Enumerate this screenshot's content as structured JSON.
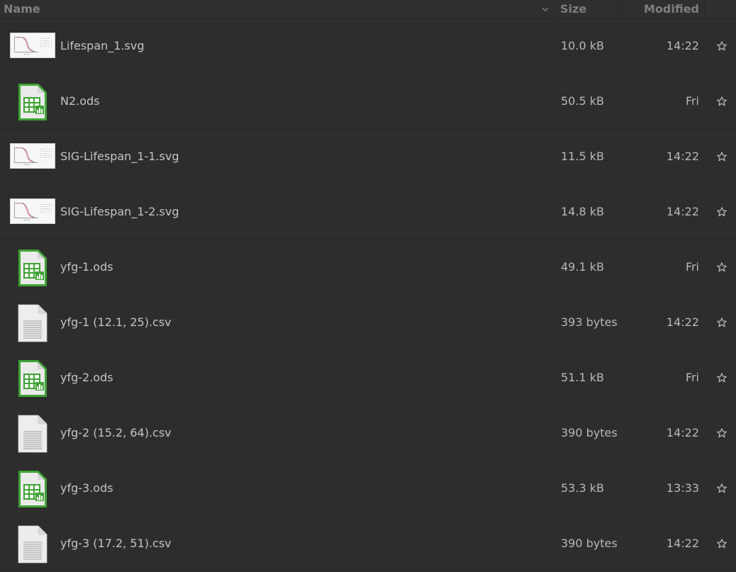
{
  "header": {
    "name": "Name",
    "size": "Size",
    "modified": "Modified"
  },
  "icons": {
    "sort": "chevron-down-icon",
    "star": "star-outline-icon",
    "svg": "svg-image-thumbnail",
    "ods": "spreadsheet-icon",
    "csv": "text-document-icon"
  },
  "colors": {
    "background": "#2b2b2b",
    "text": "#c4c4c4",
    "ods_green": "#3fa334"
  },
  "files": [
    {
      "name": "Lifespan_1.svg",
      "size": "10.0 kB",
      "modified": "14:22",
      "kind": "svg"
    },
    {
      "name": "N2.ods",
      "size": "50.5 kB",
      "modified": "Fri",
      "kind": "ods"
    },
    {
      "name": "SIG-Lifespan_1-1.svg",
      "size": "11.5 kB",
      "modified": "14:22",
      "kind": "svg"
    },
    {
      "name": "SIG-Lifespan_1-2.svg",
      "size": "14.8 kB",
      "modified": "14:22",
      "kind": "svg"
    },
    {
      "name": "yfg-1.ods",
      "size": "49.1 kB",
      "modified": "Fri",
      "kind": "ods"
    },
    {
      "name": "yfg-1 (12.1, 25).csv",
      "size": "393 bytes",
      "modified": "14:22",
      "kind": "csv"
    },
    {
      "name": "yfg-2.ods",
      "size": "51.1 kB",
      "modified": "Fri",
      "kind": "ods"
    },
    {
      "name": "yfg-2 (15.2, 64).csv",
      "size": "390 bytes",
      "modified": "14:22",
      "kind": "csv"
    },
    {
      "name": "yfg-3.ods",
      "size": "53.3 kB",
      "modified": "13:33",
      "kind": "ods"
    },
    {
      "name": "yfg-3 (17.2, 51).csv",
      "size": "390 bytes",
      "modified": "14:22",
      "kind": "csv"
    }
  ]
}
